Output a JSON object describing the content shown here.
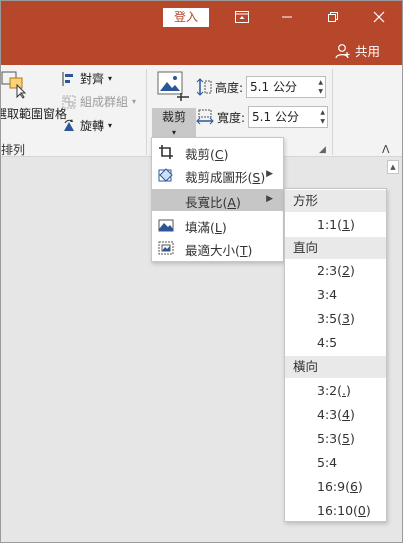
{
  "titlebar": {
    "login_label": "登入",
    "share_label": "共用",
    "accent_color": "#b7472a"
  },
  "ribbon": {
    "selection_pane_label": "選取範圍窗格",
    "align_label": "對齊",
    "group_label": "組成群組",
    "rotate_label": "旋轉",
    "arrange_group_label": "排列",
    "crop_label": "裁剪",
    "height_label": "高度:",
    "height_value": "5.1 公分",
    "width_label": "寬度:",
    "width_value": "5.1 公分"
  },
  "crop_menu": {
    "items": [
      {
        "text": "裁剪(",
        "key": "C",
        "suffix": ")",
        "icon": "crop-icon"
      },
      {
        "text": "裁剪成圖形(",
        "key": "S",
        "suffix": ")",
        "icon": "crop-shape-icon"
      },
      {
        "text": "長寬比(",
        "key": "A",
        "suffix": ")",
        "icon": ""
      },
      {
        "text": "填滿(",
        "key": "L",
        "suffix": ")",
        "icon": "fill-icon"
      },
      {
        "text": "最適大小(",
        "key": "T",
        "suffix": ")",
        "icon": "fit-icon"
      }
    ]
  },
  "aspect_menu": {
    "square_header": "方形",
    "square_1": {
      "t": "1:1(",
      "k": "1",
      "s": ")"
    },
    "portrait_header": "直向",
    "portrait_1": {
      "t": "2:3(",
      "k": "2",
      "s": ")"
    },
    "portrait_2": {
      "t": "3:4",
      "k": "",
      "s": ""
    },
    "portrait_3": {
      "t": "3:5(",
      "k": "3",
      "s": ")"
    },
    "portrait_4": {
      "t": "4:5",
      "k": "",
      "s": ""
    },
    "landscape_header": "橫向",
    "landscape_1": {
      "t": "3:2(",
      "k": ".",
      "s": ")"
    },
    "landscape_2": {
      "t": "4:3(",
      "k": "4",
      "s": ")"
    },
    "landscape_3": {
      "t": "5:3(",
      "k": "5",
      "s": ")"
    },
    "landscape_4": {
      "t": "5:4",
      "k": "",
      "s": ""
    },
    "landscape_5": {
      "t": "16:9(",
      "k": "6",
      "s": ")"
    },
    "landscape_6": {
      "t": "16:10(",
      "k": "0",
      "s": ")"
    }
  }
}
